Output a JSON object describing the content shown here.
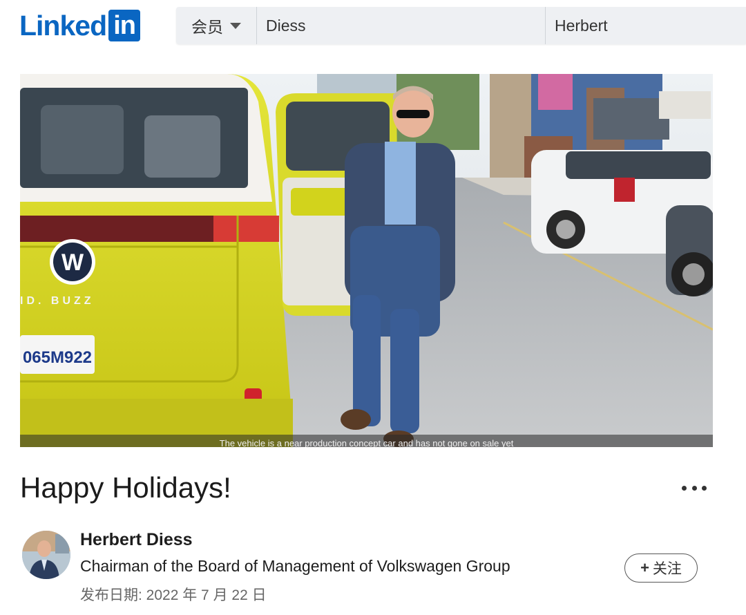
{
  "header": {
    "logo_text": "Linked",
    "logo_box": "in",
    "search": {
      "type_label": "会员",
      "first_name": "Diess",
      "last_name": "Herbert"
    }
  },
  "photo": {
    "caption": "The vehicle is a near production concept car and has not gone on sale yet",
    "plate": "065M922",
    "badge_text": "ID. BUZZ"
  },
  "post": {
    "title": "Happy Holidays!",
    "more_label": "...",
    "author": {
      "name": "Herbert Diess",
      "headline": "Chairman of the Board of Management of Volkswagen Group"
    },
    "date": "发布日期: 2022 年 7 月 22 日",
    "follow_label": "关注",
    "follow_icon": "+"
  },
  "colors": {
    "brand": "#0a66c2",
    "van_yellow": "#d8d92a"
  }
}
